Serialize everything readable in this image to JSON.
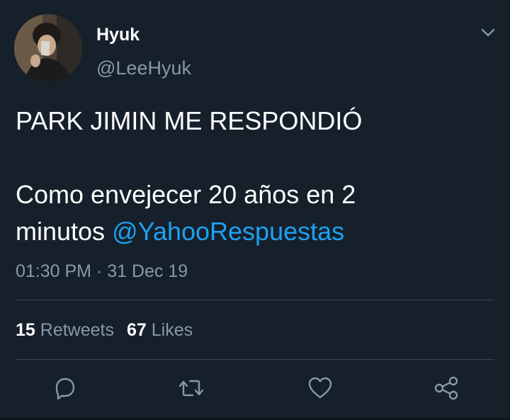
{
  "author": {
    "display_name": "Hyuk",
    "handle": "@LeeHyuk",
    "avatar_icon": "profile-photo"
  },
  "tweet": {
    "line1": "PARK JIMIN ME RESPONDIÓ",
    "line2": "Como envejecer 20 años en 2",
    "line3_prefix": "minutos ",
    "mention": "@YahooRespuestas",
    "timestamp": "01:30 PM · 31 Dec 19"
  },
  "stats": {
    "retweets_count": "15",
    "retweets_label": "Retweets",
    "likes_count": "67",
    "likes_label": "Likes"
  },
  "actions": {
    "reply_icon": "reply-icon",
    "retweet_icon": "retweet-icon",
    "like_icon": "heart-icon",
    "share_icon": "share-icon",
    "menu_icon": "chevron-down-icon"
  },
  "colors": {
    "background": "#15202b",
    "text": "#ffffff",
    "secondary": "#8899a6",
    "accent": "#1da1f2",
    "divider": "#38444d"
  }
}
